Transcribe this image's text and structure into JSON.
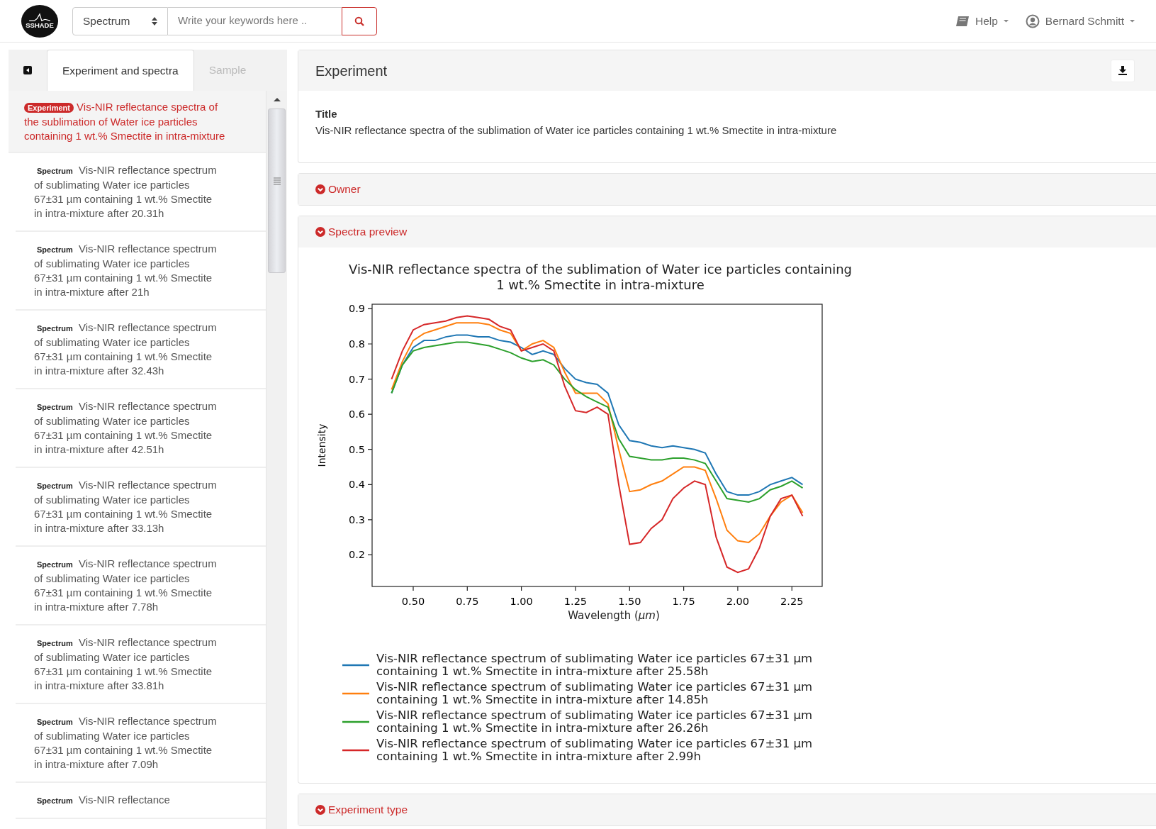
{
  "header": {
    "logo_text": "SSHADE",
    "search_type": "Spectrum",
    "search": {
      "placeholder": "Write your keywords here .."
    },
    "menus": [
      {
        "kind": "help",
        "label": "Help"
      },
      {
        "kind": "user",
        "label": "Bernard Schmitt"
      }
    ]
  },
  "sidebar": {
    "tabs": [
      {
        "label": "Experiment and spectra",
        "selected": true
      },
      {
        "label": "Sample",
        "selected": false
      }
    ],
    "items": [
      {
        "kind": "experiment",
        "badge": "Experiment",
        "text": "Vis-NIR reflectance spectra of the sublimation of Water ice particles containing 1 wt.% Smectite in intra-mixture",
        "selected": true
      },
      {
        "kind": "spectrum",
        "badge": "Spectrum",
        "text": "Vis-NIR reflectance spectrum of sublimating Water ice particles 67±31 µm containing 1 wt.% Smectite in intra-mixture after 20.31h",
        "selected": false
      },
      {
        "kind": "spectrum",
        "badge": "Spectrum",
        "text": "Vis-NIR reflectance spectrum of sublimating Water ice particles 67±31 µm containing 1 wt.% Smectite in intra-mixture after 21h",
        "selected": false
      },
      {
        "kind": "spectrum",
        "badge": "Spectrum",
        "text": "Vis-NIR reflectance spectrum of sublimating Water ice particles 67±31 µm containing 1 wt.% Smectite in intra-mixture after 32.43h",
        "selected": false
      },
      {
        "kind": "spectrum",
        "badge": "Spectrum",
        "text": "Vis-NIR reflectance spectrum of sublimating Water ice particles 67±31 µm containing 1 wt.% Smectite in intra-mixture after 42.51h",
        "selected": false
      },
      {
        "kind": "spectrum",
        "badge": "Spectrum",
        "text": "Vis-NIR reflectance spectrum of sublimating Water ice particles 67±31 µm containing 1 wt.% Smectite in intra-mixture after 33.13h",
        "selected": false
      },
      {
        "kind": "spectrum",
        "badge": "Spectrum",
        "text": "Vis-NIR reflectance spectrum of sublimating Water ice particles 67±31 µm containing 1 wt.% Smectite in intra-mixture after 7.78h",
        "selected": false
      },
      {
        "kind": "spectrum",
        "badge": "Spectrum",
        "text": "Vis-NIR reflectance spectrum of sublimating Water ice particles 67±31 µm containing 1 wt.% Smectite in intra-mixture after 33.81h",
        "selected": false
      },
      {
        "kind": "spectrum",
        "badge": "Spectrum",
        "text": "Vis-NIR reflectance spectrum of sublimating Water ice particles 67±31 µm containing 1 wt.% Smectite in intra-mixture after 7.09h",
        "selected": false
      },
      {
        "kind": "spectrum",
        "badge": "Spectrum",
        "text": "Vis-NIR reflectance",
        "selected": false
      }
    ]
  },
  "experiment": {
    "title": "Experiment",
    "fields": [
      {
        "label": "Title",
        "value": "Vis-NIR reflectance spectra of the sublimation of Water ice particles containing 1 wt.% Smectite in intra-mixture"
      }
    ]
  },
  "sections": [
    {
      "label": "Owner"
    },
    {
      "label": "Spectra preview",
      "chart_data": {
        "type": "line",
        "legend": "bottom",
        "title": "Vis-NIR reflectance spectra of the sublimation of Water ice particles containing 1 wt.% Smectite in intra-mixture",
        "xlabel": "Wavelength (*µm*)",
        "ylabel": "Intensity",
        "x": [
          0.4,
          0.45,
          0.5,
          0.55,
          0.6,
          0.65,
          0.7,
          0.75,
          0.8,
          0.85,
          0.9,
          0.95,
          1.0,
          1.05,
          1.1,
          1.15,
          1.2,
          1.25,
          1.3,
          1.35,
          1.4,
          1.45,
          1.5,
          1.55,
          1.6,
          1.65,
          1.7,
          1.75,
          1.8,
          1.85,
          1.9,
          1.95,
          2.0,
          2.05,
          2.1,
          2.15,
          2.2,
          2.25,
          2.3
        ],
        "series": [
          {
            "name": "Vis-NIR reflectance spectrum of sublimating Water ice particles 67±31 µm containing 1 wt.% Smectite in intra-mixture after 25.58h",
            "color": "#1f77b4",
            "values": [
              0.66,
              0.74,
              0.79,
              0.81,
              0.81,
              0.82,
              0.825,
              0.825,
              0.82,
              0.82,
              0.81,
              0.805,
              0.79,
              0.77,
              0.78,
              0.77,
              0.73,
              0.7,
              0.69,
              0.685,
              0.66,
              0.57,
              0.525,
              0.52,
              0.51,
              0.505,
              0.51,
              0.505,
              0.5,
              0.49,
              0.43,
              0.38,
              0.37,
              0.37,
              0.38,
              0.4,
              0.41,
              0.42,
              0.4
            ]
          },
          {
            "name": "Vis-NIR reflectance spectrum of sublimating Water ice particles 67±31 µm containing 1 wt.% Smectite in intra-mixture after 14.85h",
            "color": "#ff7f0e",
            "values": [
              0.67,
              0.75,
              0.81,
              0.83,
              0.84,
              0.85,
              0.86,
              0.86,
              0.86,
              0.855,
              0.84,
              0.83,
              0.78,
              0.8,
              0.81,
              0.79,
              0.72,
              0.66,
              0.66,
              0.66,
              0.63,
              0.5,
              0.38,
              0.385,
              0.4,
              0.41,
              0.43,
              0.45,
              0.45,
              0.44,
              0.36,
              0.27,
              0.24,
              0.235,
              0.26,
              0.31,
              0.35,
              0.37,
              0.32
            ]
          },
          {
            "name": "Vis-NIR reflectance spectrum of sublimating Water ice particles 67±31 µm containing 1 wt.% Smectite in intra-mixture after 26.26h",
            "color": "#2ca02c",
            "values": [
              0.66,
              0.74,
              0.78,
              0.79,
              0.795,
              0.8,
              0.805,
              0.805,
              0.8,
              0.795,
              0.785,
              0.775,
              0.76,
              0.75,
              0.755,
              0.74,
              0.7,
              0.67,
              0.65,
              0.635,
              0.62,
              0.53,
              0.48,
              0.475,
              0.47,
              0.47,
              0.475,
              0.475,
              0.47,
              0.46,
              0.41,
              0.36,
              0.355,
              0.35,
              0.36,
              0.385,
              0.395,
              0.41,
              0.39
            ]
          },
          {
            "name": "Vis-NIR reflectance spectrum of sublimating Water ice particles 67±31 µm containing 1 wt.% Smectite in intra-mixture after 2.99h",
            "color": "#d62728",
            "values": [
              0.7,
              0.78,
              0.84,
              0.855,
              0.86,
              0.865,
              0.875,
              0.88,
              0.875,
              0.87,
              0.85,
              0.84,
              0.78,
              0.79,
              0.8,
              0.78,
              0.68,
              0.61,
              0.605,
              0.62,
              0.6,
              0.4,
              0.23,
              0.235,
              0.275,
              0.3,
              0.36,
              0.39,
              0.41,
              0.4,
              0.25,
              0.165,
              0.15,
              0.16,
              0.22,
              0.31,
              0.36,
              0.37,
              0.31
            ]
          }
        ],
        "xlim": [
          0.31,
          2.39
        ],
        "ylim": [
          0.11,
          0.913
        ],
        "xticks": [
          {
            "value": 0.5,
            "label": "0.50"
          },
          {
            "value": 0.75,
            "label": "0.75"
          },
          {
            "value": 1.0,
            "label": "1.00"
          },
          {
            "value": 1.25,
            "label": "1.25"
          },
          {
            "value": 1.5,
            "label": "1.50"
          },
          {
            "value": 1.75,
            "label": "1.75"
          },
          {
            "value": 2.0,
            "label": "2.00"
          },
          {
            "value": 2.25,
            "label": "2.25"
          }
        ],
        "yticks": [
          {
            "value": 0.2,
            "label": "0.2"
          },
          {
            "value": 0.3,
            "label": "0.3"
          },
          {
            "value": 0.4,
            "label": "0.4"
          },
          {
            "value": 0.5,
            "label": "0.5"
          },
          {
            "value": 0.6,
            "label": "0.6"
          },
          {
            "value": 0.7,
            "label": "0.7"
          },
          {
            "value": 0.8,
            "label": "0.8"
          },
          {
            "value": 0.9,
            "label": "0.9"
          }
        ]
      }
    },
    {
      "label": "Experiment type"
    }
  ]
}
